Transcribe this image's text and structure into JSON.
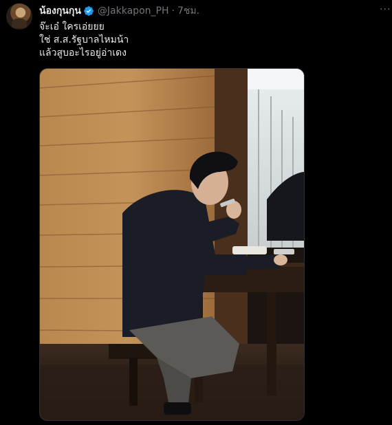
{
  "tweet": {
    "display_name": "น้องกุนกุน",
    "handle": "@Jakkapon_PH",
    "separator": "·",
    "time": "7ชม.",
    "more_label": "···",
    "text_lines": [
      "จ๊ะเอ๋ ใครเอ่ยยย",
      "ใช่ ส.ส.รัฐบาลไหมน้า",
      "แล้วสูบอะไรอยู่อ่าเดง"
    ]
  },
  "icons": {
    "verified": "verified-badge-icon",
    "more": "more-options-icon"
  },
  "colors": {
    "background": "#000000",
    "text_primary": "#e7e9ea",
    "text_secondary": "#71767b",
    "verified_blue": "#1d9bf0"
  }
}
